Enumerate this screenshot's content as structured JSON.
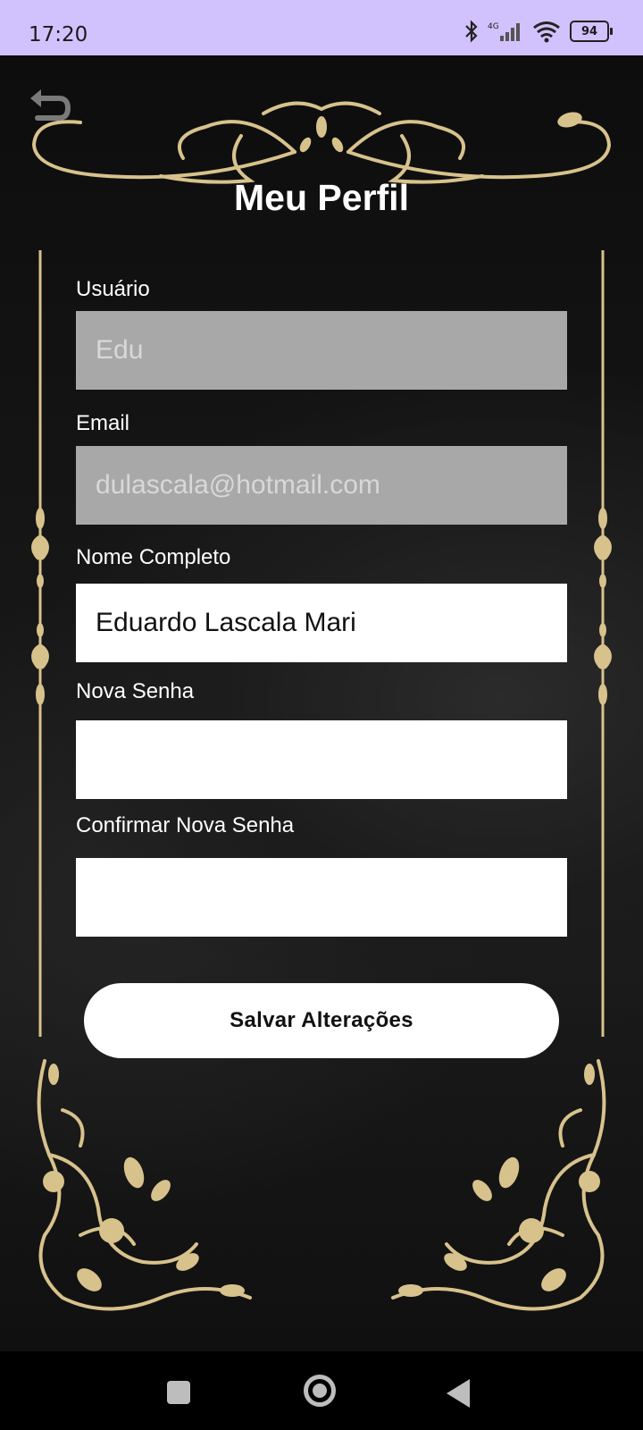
{
  "status_bar": {
    "time": "17:20",
    "battery": "94",
    "icons": [
      "bluetooth-icon",
      "signal-4g-icon",
      "wifi-icon",
      "battery-icon"
    ]
  },
  "header": {
    "title": "Meu Perfil",
    "back_icon": "back-arrow-icon"
  },
  "form": {
    "username": {
      "label": "Usuário",
      "value": "Edu",
      "enabled": false
    },
    "email": {
      "label": "Email",
      "value": "dulascala@hotmail.com",
      "enabled": false
    },
    "full_name": {
      "label": "Nome Completo",
      "value": "Eduardo Lascala Mari",
      "enabled": true
    },
    "new_password": {
      "label": "Nova Senha",
      "value": "",
      "enabled": true
    },
    "confirm_password": {
      "label": "Confirmar Nova Senha",
      "value": "",
      "enabled": true
    },
    "save_label": "Salvar Alterações"
  },
  "colors": {
    "ornament_gold": "#d8c28c",
    "status_bar": "#d1c2fd",
    "disabled_field": "#a8a8a8"
  },
  "nav_bar": {
    "icons": [
      "recent-apps-icon",
      "home-icon",
      "back-icon"
    ]
  }
}
